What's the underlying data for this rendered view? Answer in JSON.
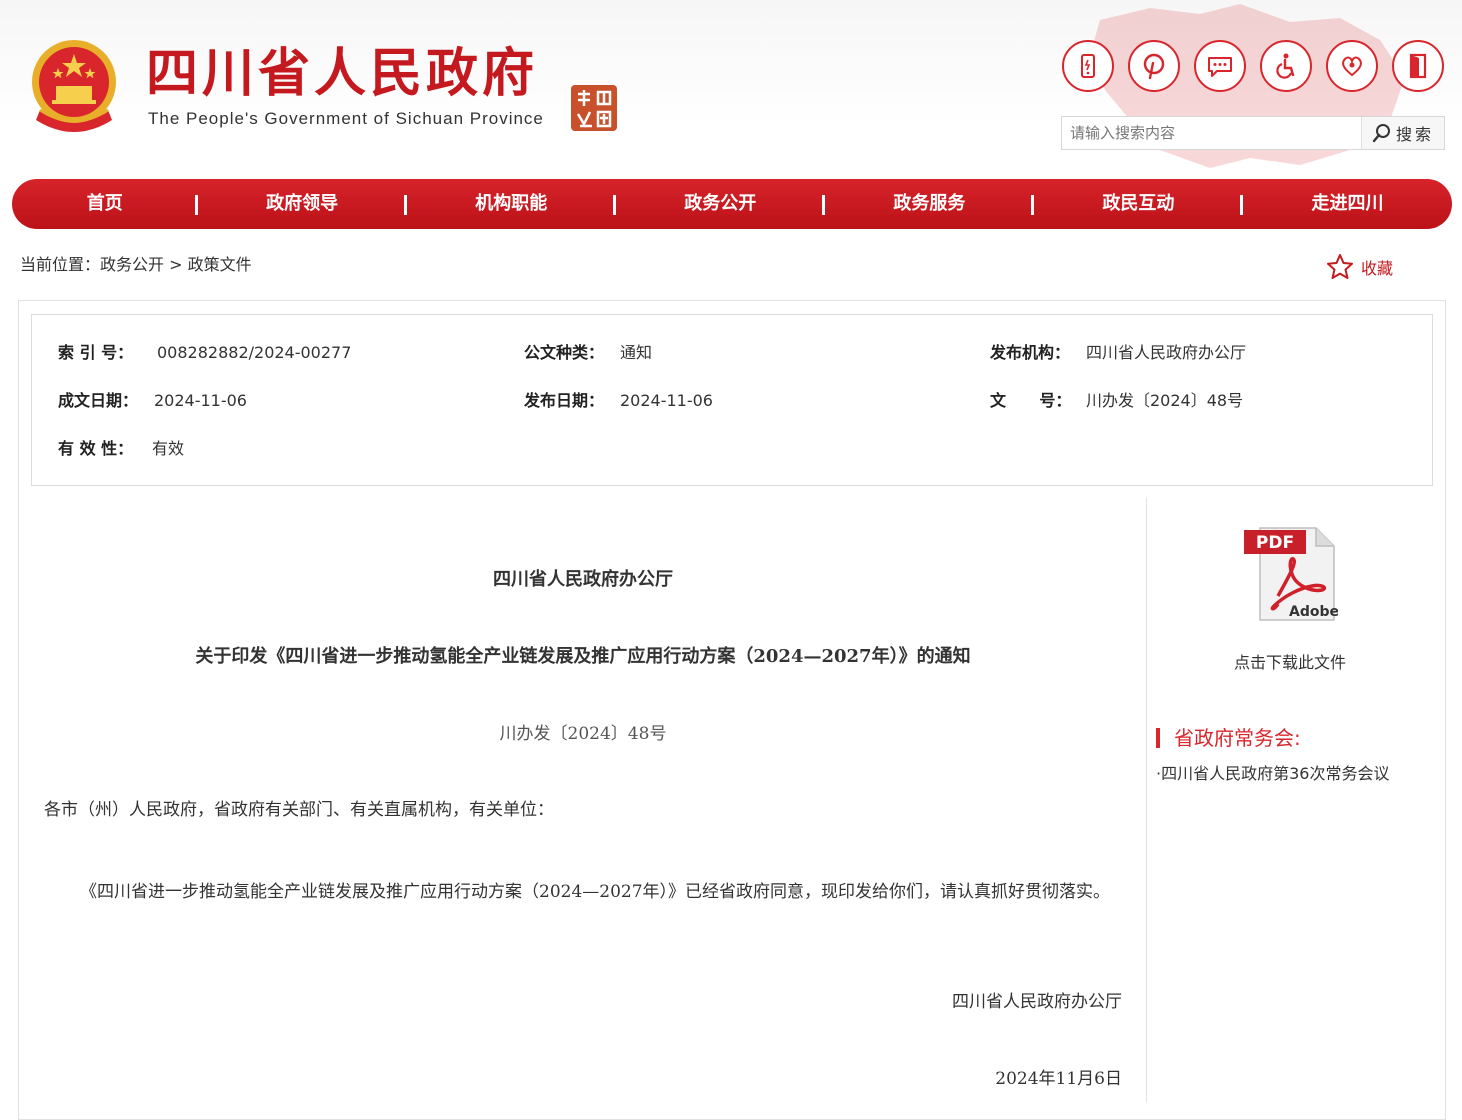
{
  "header": {
    "site_title": "四川省人民政府",
    "site_subtitle": "The People's Government of Sichuan Province",
    "tools": [
      {
        "icon": "mobile-icon"
      },
      {
        "icon": "weibo-icon"
      },
      {
        "icon": "message-icon"
      },
      {
        "icon": "accessibility-icon"
      },
      {
        "icon": "care-mode-icon"
      },
      {
        "icon": "login-door-icon"
      }
    ],
    "search": {
      "placeholder": "请输入搜索内容",
      "button_label": "搜索"
    },
    "brand_color": "#c41a1f"
  },
  "nav": {
    "items": [
      "首页",
      "政府领导",
      "机构职能",
      "政务公开",
      "政务服务",
      "政民互动",
      "走进四川"
    ]
  },
  "breadcrumb": {
    "prefix": "当前位置：",
    "items": [
      "政务公开",
      "政策文件"
    ],
    "separator": ">",
    "favorite_label": "收藏"
  },
  "meta": {
    "index_no": {
      "label": "索 引 号：",
      "value": "008282882/2024-00277"
    },
    "doc_type": {
      "label": "公文种类：",
      "value": "通知"
    },
    "publisher": {
      "label": "发布机构：",
      "value": "四川省人民政府办公厅"
    },
    "written_date": {
      "label": "成文日期：",
      "value": "2024-11-06"
    },
    "publish_date": {
      "label": "发布日期：",
      "value": "2024-11-06"
    },
    "doc_number": {
      "label": "文      号：",
      "value": "川办发〔2024〕48号"
    },
    "validity": {
      "label": "有 效 性：",
      "value": "有效"
    }
  },
  "document": {
    "issuer": "四川省人民政府办公厅",
    "title": "关于印发《四川省进一步推动氢能全产业链发展及推广应用行动方案（2024—2027年）》的通知",
    "number": "川办发〔2024〕48号",
    "addressee": "各市（州）人民政府，省政府有关部门、有关直属机构，有关单位：",
    "body": "《四川省进一步推动氢能全产业链发展及推广应用行动方案（2024—2027年）》已经省政府同意，现印发给你们，请认真抓好贯彻落实。",
    "signature": "四川省人民政府办公厅",
    "date": "2024年11月6日"
  },
  "sidebar": {
    "pdf_badge": "PDF",
    "pdf_brand": "Adobe",
    "download_label": "点击下载此文件",
    "section_heading": "省政府常务会:",
    "meeting_link": "·四川省人民政府第36次常务会议"
  }
}
